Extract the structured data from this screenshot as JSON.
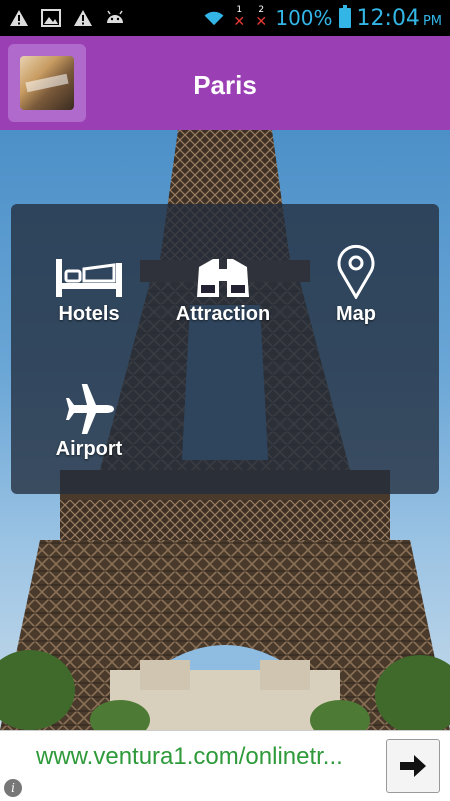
{
  "status_bar": {
    "battery_text": "100%",
    "time": "12:04",
    "ampm": "PM",
    "sim1": "1",
    "sim2": "2",
    "icons": [
      "warning-icon",
      "image-icon",
      "warning-icon",
      "android-icon",
      "wifi-icon",
      "sim1-no-signal-icon",
      "sim2-no-signal-icon",
      "battery-icon"
    ]
  },
  "app_bar": {
    "title": "Paris",
    "color": "#9b3fb5"
  },
  "menu": {
    "items": [
      {
        "label": "Hotels",
        "icon": "bed-icon"
      },
      {
        "label": "Attraction",
        "icon": "binoculars-icon"
      },
      {
        "label": "Map",
        "icon": "map-pin-icon"
      },
      {
        "label": "Airport",
        "icon": "airplane-icon"
      }
    ]
  },
  "ad": {
    "url": "www.ventura1.com/onlinetr...",
    "arrow": "arrow-right-icon",
    "info": "i"
  }
}
